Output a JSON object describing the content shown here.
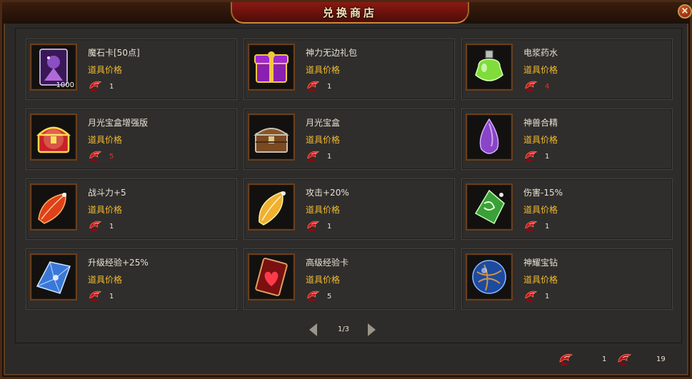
{
  "window": {
    "title": "兑换商店",
    "close_label": "×"
  },
  "price_label": "道具价格",
  "items": [
    {
      "name": "魔石卡[50点]",
      "price": "1",
      "qty": "1000",
      "price_color": "normal",
      "icon": "card-purple-icon"
    },
    {
      "name": "神力无边礼包",
      "price": "1",
      "price_color": "normal",
      "icon": "purple-giftbox-icon"
    },
    {
      "name": "电浆药水",
      "price": "4",
      "price_color": "red",
      "icon": "green-potion-icon"
    },
    {
      "name": "月光宝盒增强版",
      "price": "5",
      "price_color": "red",
      "icon": "gold-chest-icon"
    },
    {
      "name": "月光宝盒",
      "price": "1",
      "price_color": "normal",
      "icon": "wood-chest-icon"
    },
    {
      "name": "神兽合精",
      "price": "1",
      "price_color": "normal",
      "icon": "purple-crystal-icon"
    },
    {
      "name": "战斗力+5",
      "price": "1",
      "price_color": "normal",
      "icon": "red-leaf-gem-icon"
    },
    {
      "name": "攻击+20%",
      "price": "1",
      "price_color": "normal",
      "icon": "gold-leaf-gem-icon"
    },
    {
      "name": "伤害-15%",
      "price": "1",
      "price_color": "normal",
      "icon": "green-rune-gem-icon"
    },
    {
      "name": "升级经验+25%",
      "price": "1",
      "price_color": "normal",
      "icon": "blue-gem-icon"
    },
    {
      "name": "高级经验卡",
      "price": "5",
      "price_color": "normal",
      "icon": "heart-card-icon"
    },
    {
      "name": "神耀宝钻",
      "price": "1",
      "price_color": "normal",
      "icon": "blue-orb-gem-icon"
    }
  ],
  "pagination": {
    "label": "1/3"
  },
  "currency": [
    {
      "icon": "red-gem-currency-icon",
      "value": "1"
    },
    {
      "icon": "red-gem-currency-alt-icon",
      "value": "19"
    }
  ],
  "colors": {
    "price_label": "#f3b92f",
    "red_price": "#e53221",
    "frame": "#6a3f1c"
  }
}
